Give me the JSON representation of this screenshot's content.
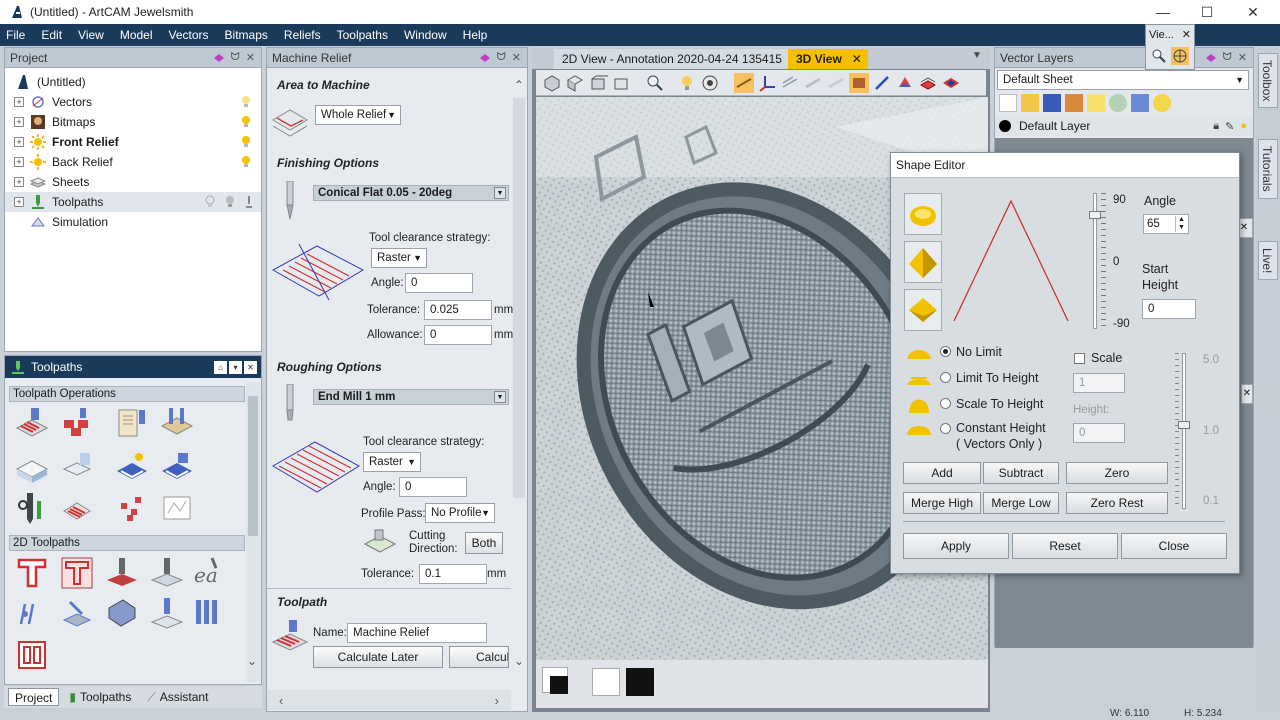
{
  "window": {
    "title": "(Untitled) - ArtCAM Jewelsmith",
    "controls": [
      "—",
      "☐",
      "✕"
    ]
  },
  "menubar": [
    "File",
    "Edit",
    "View",
    "Model",
    "Vectors",
    "Bitmaps",
    "Reliefs",
    "Toolpaths",
    "Window",
    "Help"
  ],
  "project": {
    "header": "Project",
    "tree": [
      {
        "label": "(Untitled)",
        "bold": false
      },
      {
        "label": "Vectors",
        "bold": false
      },
      {
        "label": "Bitmaps",
        "bold": false
      },
      {
        "label": "Front Relief",
        "bold": true
      },
      {
        "label": "Back Relief",
        "bold": false
      },
      {
        "label": "Sheets",
        "bold": false
      },
      {
        "label": "Toolpaths",
        "bold": false
      },
      {
        "label": "Simulation",
        "bold": false
      }
    ]
  },
  "toolpaths_dock": {
    "header": "Toolpaths",
    "section1": "Toolpath Operations",
    "section2": "2D Toolpaths"
  },
  "bottom_tabs": [
    "Project",
    "Toolpaths",
    "Assistant"
  ],
  "machine_relief": {
    "header": "Machine Relief",
    "area_title": "Area to Machine",
    "area_value": "Whole Relief",
    "finishing_title": "Finishing Options",
    "finishing_tool": "Conical Flat 0.05 - 20deg",
    "clearance_label": "Tool clearance strategy:",
    "finishing_strategy": "Raster",
    "angle_label": "Angle:",
    "finishing_angle": "0",
    "tolerance_label": "Tolerance:",
    "finishing_tolerance": "0.025",
    "allowance_label": "Allowance:",
    "finishing_allowance": "0",
    "unit": "mm",
    "roughing_title": "Roughing Options",
    "roughing_tool": "End Mill 1 mm",
    "roughing_strategy": "Raster",
    "roughing_angle": "0",
    "profile_label": "Profile Pass:",
    "profile_value": "No Profile",
    "cutting_label_1": "Cutting",
    "cutting_label_2": "Direction:",
    "cutting_value": "Both",
    "roughing_tolerance": "0.1",
    "toolpath_title": "Toolpath",
    "name_label": "Name:",
    "name_value": "Machine Relief",
    "calc_later": "Calculate Later",
    "calc_now": "Calcula"
  },
  "view_tabs": {
    "tab1": "2D View - Annotation 2020-04-24 135415",
    "tab2": "3D View"
  },
  "mini_panel": {
    "title": "Vie..."
  },
  "layers": {
    "header": "Vector Layers",
    "sheet": "Default Sheet",
    "layer": "Default Layer"
  },
  "side_tabs": [
    "Toolbox",
    "Tutorials",
    "Live!"
  ],
  "shape_editor": {
    "title": "Shape Editor",
    "slider_top": "90",
    "slider_mid": "0",
    "slider_bot": "-90",
    "angle_label": "Angle",
    "angle_value": "65",
    "start_height_label_1": "Start",
    "start_height_label_2": "Height",
    "start_height_value": "0",
    "opt_no_limit": "No Limit",
    "opt_limit": "Limit To Height",
    "opt_scale": "Scale To Height",
    "opt_constant_1": "Constant Height",
    "opt_constant_2": "( Vectors Only )",
    "scale_label": "Scale",
    "scale_value": "1",
    "height_label": "Height:",
    "height_value": "0",
    "right_top": "5.0",
    "right_mid": "1.0",
    "right_bot": "0.1",
    "btn_add": "Add",
    "btn_subtract": "Subtract",
    "btn_zero": "Zero",
    "btn_merge_high": "Merge High",
    "btn_merge_low": "Merge Low",
    "btn_zero_rest": "Zero Rest",
    "btn_apply": "Apply",
    "btn_reset": "Reset",
    "btn_close": "Close"
  },
  "status": {
    "w": "W: 6.110",
    "h": "H: 5.234"
  },
  "colors": {
    "menubar": "#1a3a5c",
    "accent": "#f6c000",
    "profile_line": "#cc2b22"
  }
}
